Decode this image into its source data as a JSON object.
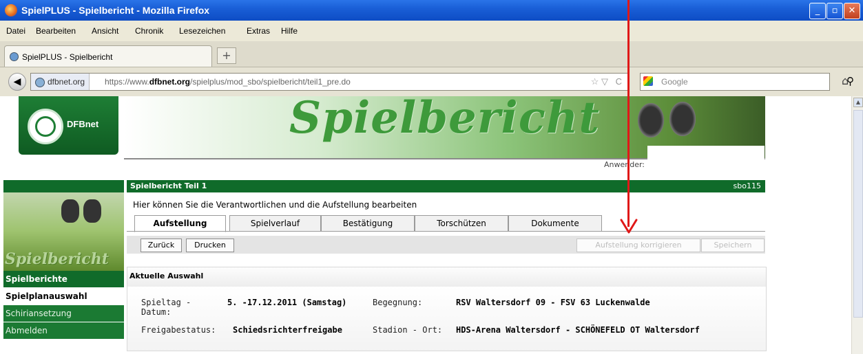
{
  "window": {
    "title": "SpielPLUS - Spielbericht - Mozilla Firefox"
  },
  "menu": [
    "Datei",
    "Bearbeiten",
    "Ansicht",
    "Chronik",
    "Lesezeichen",
    "Extras",
    "Hilfe"
  ],
  "browser_tab": {
    "label": "SpielPLUS - Spielbericht"
  },
  "address": {
    "site": "dfbnet.org",
    "url_prefix": "https://www.",
    "url_domain": "dfbnet.org",
    "url_path": "/spielplus/mod_sbo/spielbericht/teil1_pre.do"
  },
  "search": {
    "placeholder": "Google"
  },
  "banner": {
    "logo_text": "DFBnet",
    "title": "Spielbericht",
    "user_label": "Anwender:"
  },
  "sidebar": {
    "image_text": "Spielbericht",
    "items": [
      "Spielberichte",
      "Spielplanauswahl",
      "Schiriansetzung",
      "Abmelden"
    ]
  },
  "section": {
    "title": "Spielbericht Teil 1",
    "code": "sbo115"
  },
  "hint": "Hier können Sie die Verantwortlichen und die Aufstellung bearbeiten",
  "tabs": [
    "Aufstellung",
    "Spielverlauf",
    "Bestätigung",
    "Torschützen",
    "Dokumente"
  ],
  "toolbar": {
    "back": "Zurück",
    "print": "Drucken",
    "correct": "Aufstellung korrigieren",
    "save": "Speichern"
  },
  "selection": {
    "title": "Aktuelle Auswahl",
    "spieltag_label": "Spieltag -",
    "datum_label": "Datum:",
    "spieltag_value": "5. -17.12.2011 (Samstag)",
    "begegnung_label": "Begegnung:",
    "begegnung_value": "RSV Waltersdorf 09 - FSV 63 Luckenwalde",
    "freigabe_label": "Freigabestatus:",
    "freigabe_value": "Schiedsrichterfreigabe",
    "stadion_label": "Stadion - Ort:",
    "stadion_value": "HDS-Arena Waltersdorf - SCHÖNEFELD OT Waltersdorf"
  },
  "colors": {
    "dfb_green": "#106b2a",
    "annotation_red": "#e01818",
    "titlebar_blue": "#1a5fd7"
  }
}
